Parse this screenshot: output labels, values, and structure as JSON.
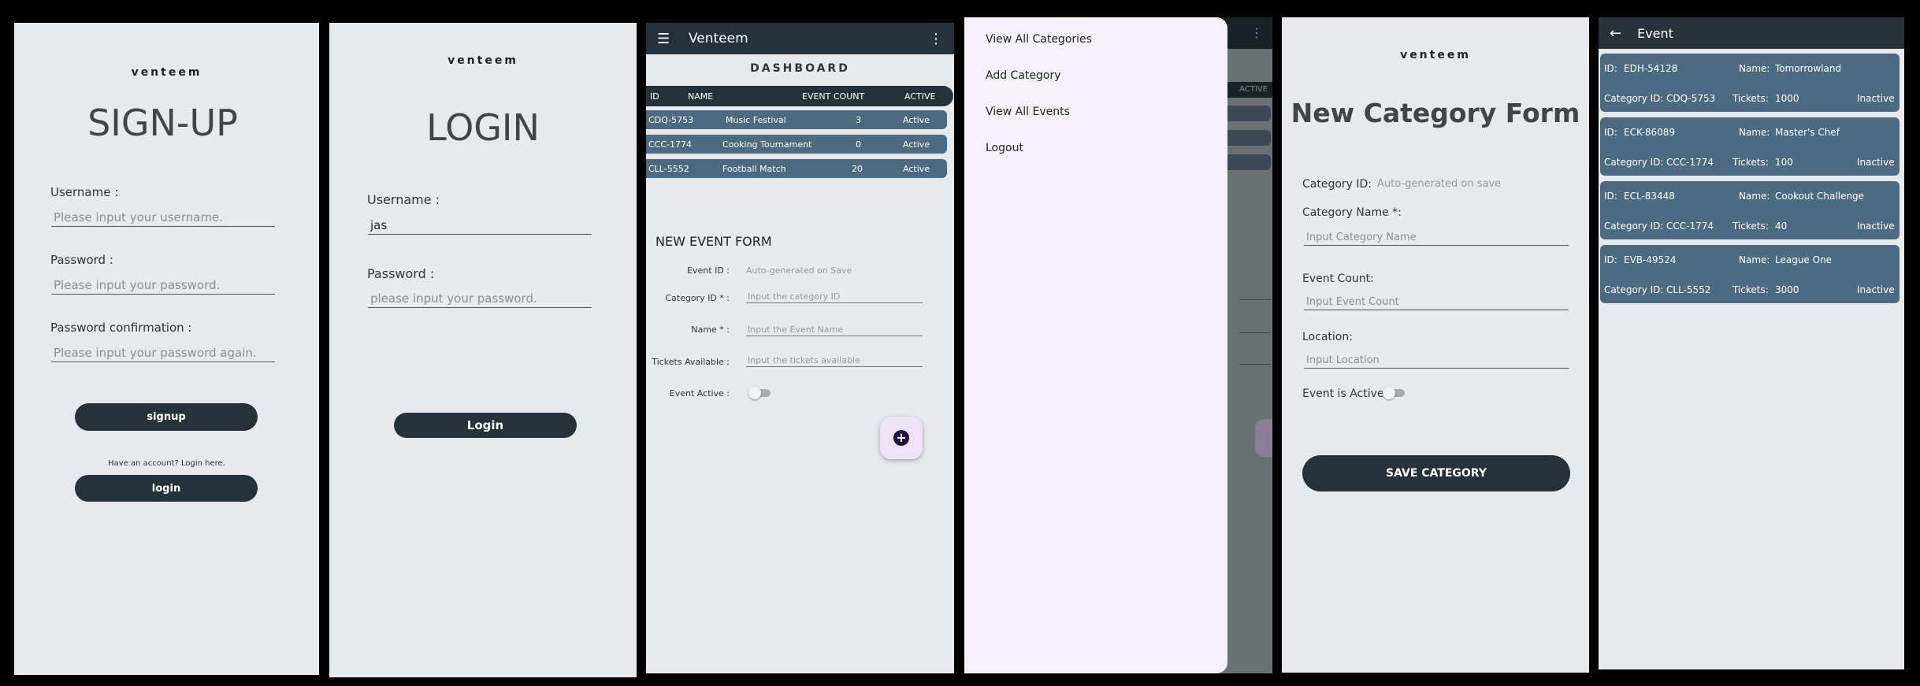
{
  "signup": {
    "brand": "venteem",
    "title": "SIGN-UP",
    "username_label": "Username :",
    "username_placeholder": "Please input your username.",
    "password_label": "Password :",
    "password_placeholder": "Please input your password.",
    "confirm_label": "Password confirmation :",
    "confirm_placeholder": "Please input your password again.",
    "signup_button": "signup",
    "have_account": "Have an account? Login here.",
    "login_button": "login"
  },
  "login": {
    "brand": "venteem",
    "title": "LOGIN",
    "username_label": "Username :",
    "username_value": "jas",
    "password_label": "Password :",
    "password_placeholder": "please input your password.",
    "login_button": "Login"
  },
  "dashboard": {
    "app_title": "Venteem",
    "heading": "DASHBOARD",
    "columns": [
      "ID",
      "NAME",
      "EVENT COUNT",
      "ACTIVE"
    ],
    "rows": [
      {
        "id": "CDQ-5753",
        "name": "Music Festival",
        "count": "3",
        "active": "Active"
      },
      {
        "id": "CCC-1774",
        "name": "Cooking Tournament",
        "count": "0",
        "active": "Active"
      },
      {
        "id": "CLL-5552",
        "name": "Football Match",
        "count": "20",
        "active": "Active"
      }
    ],
    "form_title": "NEW EVENT FORM",
    "event_id_label": "Event ID :",
    "event_id_value": "Auto-generated on Save",
    "category_id_label": "Category ID * :",
    "category_id_placeholder": "Input the category ID",
    "name_label": "Name * :",
    "name_placeholder": "Input the Event Name",
    "tickets_label": "Tickets Available :",
    "tickets_placeholder": "Input the tickets available",
    "active_label": "Event Active :",
    "fab_icon": "plus-icon"
  },
  "drawer": {
    "items": [
      "View All Categories",
      "Add Category",
      "View All Events",
      "Logout"
    ],
    "behind_header": "ACTIVE"
  },
  "category_form": {
    "brand": "venteem",
    "title": "New Category Form",
    "category_id_label": "Category ID:",
    "category_id_value": "Auto-generated on save",
    "category_name_label": "Category Name *:",
    "category_name_placeholder": "Input Category Name",
    "event_count_label": "Event Count:",
    "event_count_placeholder": "Input Event Count",
    "location_label": "Location:",
    "location_placeholder": "Input Location",
    "active_label": "Event is Active?",
    "save_button": "SAVE CATEGORY"
  },
  "events": {
    "title": "Event",
    "id_label": "ID:",
    "name_label": "Name:",
    "category_label": "Category ID:",
    "tickets_label": "Tickets:",
    "items": [
      {
        "id": "EDH-54128",
        "name": "Tomorrowland",
        "category": "CDQ-5753",
        "tickets": "1000",
        "status": "Inactive"
      },
      {
        "id": "ECK-86089",
        "name": "Master's Chef",
        "category": "CCC-1774",
        "tickets": "100",
        "status": "Inactive"
      },
      {
        "id": "ECL-83448",
        "name": "Cookout Challenge",
        "category": "CCC-1774",
        "tickets": "40",
        "status": "Inactive"
      },
      {
        "id": "EVB-49524",
        "name": "League One",
        "category": "CLL-5552",
        "tickets": "3000",
        "status": "Inactive"
      }
    ]
  }
}
